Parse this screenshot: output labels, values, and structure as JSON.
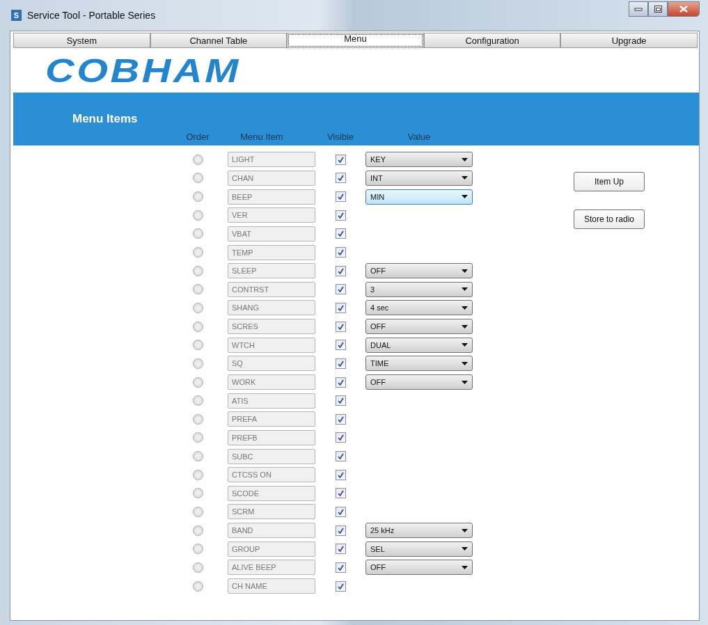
{
  "window": {
    "icon_letter": "S",
    "title": "Service Tool - Portable Series"
  },
  "tabs": [
    {
      "label": "System",
      "selected": false
    },
    {
      "label": "Channel Table",
      "selected": false
    },
    {
      "label": "Menu",
      "selected": true
    },
    {
      "label": "Configuration",
      "selected": false
    },
    {
      "label": "Upgrade",
      "selected": false
    }
  ],
  "logo": "COBHAM",
  "section_title": "Menu Items",
  "columns": [
    "Order",
    "Menu Item",
    "Visible",
    "Value"
  ],
  "rows": [
    {
      "name": "LIGHT",
      "selected": false,
      "visible": true,
      "value": {
        "text": "KEY",
        "focused": false
      }
    },
    {
      "name": "CHAN",
      "selected": false,
      "visible": true,
      "value": {
        "text": "INT",
        "focused": false
      }
    },
    {
      "name": "BEEP",
      "selected": false,
      "visible": true,
      "value": {
        "text": "MIN",
        "focused": true
      }
    },
    {
      "name": "VER",
      "selected": false,
      "visible": true
    },
    {
      "name": "VBAT",
      "selected": false,
      "visible": true
    },
    {
      "name": "TEMP",
      "selected": false,
      "visible": true
    },
    {
      "name": "SLEEP",
      "selected": false,
      "visible": true,
      "value": {
        "text": "OFF",
        "focused": false
      }
    },
    {
      "name": "CONTRST",
      "selected": false,
      "visible": true,
      "value": {
        "text": "3",
        "focused": false
      }
    },
    {
      "name": "SHANG",
      "selected": false,
      "visible": true,
      "value": {
        "text": "4 sec",
        "focused": false
      }
    },
    {
      "name": "SCRES",
      "selected": false,
      "visible": true,
      "value": {
        "text": "OFF",
        "focused": false
      }
    },
    {
      "name": "WTCH",
      "selected": false,
      "visible": true,
      "value": {
        "text": "DUAL",
        "focused": false
      }
    },
    {
      "name": "SQ",
      "selected": false,
      "visible": true,
      "value": {
        "text": "TIME",
        "focused": false
      }
    },
    {
      "name": "WORK",
      "selected": false,
      "visible": true,
      "value": {
        "text": "OFF",
        "focused": false
      }
    },
    {
      "name": "ATIS",
      "selected": false,
      "visible": true
    },
    {
      "name": "PREFA",
      "selected": false,
      "visible": true
    },
    {
      "name": "PREFB",
      "selected": false,
      "visible": true
    },
    {
      "name": "SUBC",
      "selected": false,
      "visible": true
    },
    {
      "name": "CTCSS ON",
      "selected": false,
      "visible": true
    },
    {
      "name": "SCODE",
      "selected": false,
      "visible": true
    },
    {
      "name": "SCRM",
      "selected": false,
      "visible": true
    },
    {
      "name": "BAND",
      "selected": false,
      "visible": true,
      "value": {
        "text": "25 kHz",
        "focused": false
      }
    },
    {
      "name": "GROUP",
      "selected": false,
      "visible": true,
      "value": {
        "text": "SEL",
        "focused": false
      }
    },
    {
      "name": "ALIVE BEEP",
      "selected": false,
      "visible": true,
      "value": {
        "text": "OFF",
        "focused": false
      }
    },
    {
      "name": "CH NAME",
      "selected": false,
      "visible": true
    }
  ],
  "buttons": [
    "Item Up",
    "Store to radio"
  ]
}
